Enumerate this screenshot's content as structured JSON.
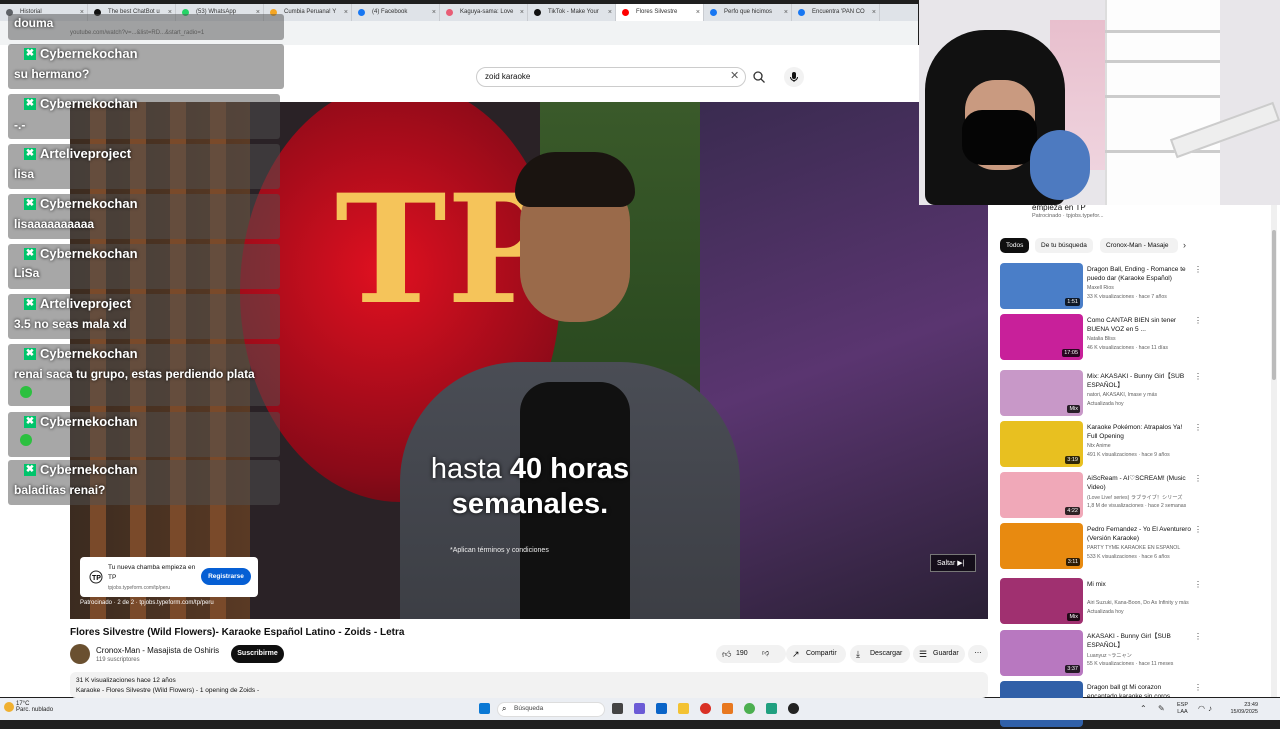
{
  "browser": {
    "tabs": [
      {
        "label": "Historial",
        "color": "#5f6368"
      },
      {
        "label": "The best ChatBot u",
        "color": "#111111"
      },
      {
        "label": "(53) WhatsApp",
        "color": "#25d366"
      },
      {
        "label": "Cumbia Peruana! Y",
        "color": "#f5a623"
      },
      {
        "label": "(4) Facebook",
        "color": "#1877f2"
      },
      {
        "label": "Kaguya-sama: Love",
        "color": "#e85d75"
      },
      {
        "label": "TikTok - Make Your",
        "color": "#111111"
      },
      {
        "label": "Flores Silvestre",
        "color": "#ff0000"
      },
      {
        "label": "Perfo que hicimos",
        "color": "#1877f2"
      },
      {
        "label": "Encuentra 'PAN CO",
        "color": "#1877f2"
      }
    ],
    "url": "youtube.com/watch?v=...&list=RD...&start_radio=1"
  },
  "youtube": {
    "search_value": "zoid karaoke",
    "video": {
      "subtitle_line1_pre": "hasta ",
      "subtitle_line1_bold": "40 horas",
      "subtitle_line2": "semanales.",
      "legal": "*Aplican términos y condiciones",
      "ad_headline": "Tu nueva chamba empieza en TP",
      "ad_domain": "tpjobs.typeform.com/tp/peru",
      "ad_button": "Registrarse",
      "ad_meta": "Patrocinado · 2 de 2 · tpjobs.typeform.com/tp/peru",
      "skip": "Saltar"
    },
    "title": "Flores Silvestre (Wild Flowers)- Karaoke Español Latino - Zoids - Letra",
    "channel": "Cronox-Man - Masajista de Oshiris",
    "subscribers": "119 suscriptores",
    "subscribe": "Suscribirme",
    "likes": "190",
    "share": "Compartir",
    "download": "Descargar",
    "save": "Guardar",
    "desc_line1": "31 K visualizaciones  hace 12 años",
    "desc_line2": "Karaoke - Flores Silvestre (Wild Flowers) - 1 opening de Zoids -",
    "side_ad_title": "empieza en TP",
    "side_ad_sub": "Patrocinado · tpjobs.typefor...",
    "chips": [
      "Todos",
      "De tu búsqueda",
      "Cronox-Man - Masaje"
    ],
    "recommendations": [
      {
        "title": "Dragon Ball, Ending - Romance te puedo dar (Karaoke Español)",
        "channel": "Maxell Rios",
        "meta": "33 K visualizaciones · hace 7 años",
        "duration": "1:51",
        "thumb": "#4a7ec8"
      },
      {
        "title": "Como CANTAR BIEN sin tener BUENA VOZ en 5 ...",
        "channel": "Natalia Bliss",
        "meta": "46 K visualizaciones · hace 11 días",
        "duration": "17:05",
        "thumb": "#c8209a"
      },
      {
        "title": "Mix: AKASAKI - Bunny Girl【SUB ESPAÑOL】",
        "channel": "natori, AKASAKI, Imase y más",
        "meta": "Actualizada hoy",
        "duration": "Mix",
        "thumb": "#c898c8"
      },
      {
        "title": "Karaoke Pokémon: Atrapalos Ya! Full Opening",
        "channel": "Ntx Anime",
        "meta": "491 K visualizaciones · hace 9 años",
        "duration": "3:19",
        "thumb": "#e8c020"
      },
      {
        "title": "AiScReam - AI♡SCREAM! (Music Video)",
        "channel": "(Love Live! series) ラブライブ！シリーズ",
        "meta": "1,8 M de visualizaciones · hace 2 semanas",
        "duration": "4:22",
        "thumb": "#f0a8b8"
      },
      {
        "title": "Pedro Fernandez - Yo El Aventurero (Versión Karaoke)",
        "channel": "PARTY TYME KARAOKE EN ESPAÑOL",
        "meta": "533 K visualizaciones · hace 6 años",
        "duration": "3:11",
        "thumb": "#e88a10"
      },
      {
        "title": "Mi mix",
        "channel": "Airi Suzuki, Kana-Boon, Do As Infinity y más",
        "meta": "Actualizada hoy",
        "duration": "Mix",
        "thumb": "#a03070"
      },
      {
        "title": "AKASAKI - Bunny Girl【SUB ESPAÑOL】",
        "channel": "Luanyuz ~ラニャン",
        "meta": "55 K visualizaciones · hace 11 meses",
        "duration": "3:37",
        "thumb": "#b878c0"
      },
      {
        "title": "Dragon ball gt Mi corazon encantado karaoke sin coros",
        "channel": "",
        "meta": "",
        "duration": "",
        "thumb": "#3060a8"
      }
    ]
  },
  "chat": [
    {
      "user": "",
      "msg": "douma"
    },
    {
      "user": "Cybernekochan",
      "msg": "su hermano?"
    },
    {
      "user": "Cybernekochan",
      "msg": "-.-"
    },
    {
      "user": "Arteliveproject",
      "msg": "lisa"
    },
    {
      "user": "Cybernekochan",
      "msg": "lisaaaaaaaaaa"
    },
    {
      "user": "Cybernekochan",
      "msg": "LiSa"
    },
    {
      "user": "Arteliveproject",
      "msg": "3.5 no seas mala xd"
    },
    {
      "user": "Cybernekochan",
      "msg": "renai saca tu grupo, estas perdiendo plata"
    },
    {
      "user": "Cybernekochan",
      "msg": ""
    },
    {
      "user": "Cybernekochan",
      "msg": "baladitas renai?"
    }
  ],
  "taskbar": {
    "weather_temp": "17°C",
    "weather_desc": "Parc. nublado",
    "search": "Búsqueda",
    "lang": "ESP",
    "lang2": "LAA",
    "time": "23:49",
    "date": "15/09/2025"
  }
}
